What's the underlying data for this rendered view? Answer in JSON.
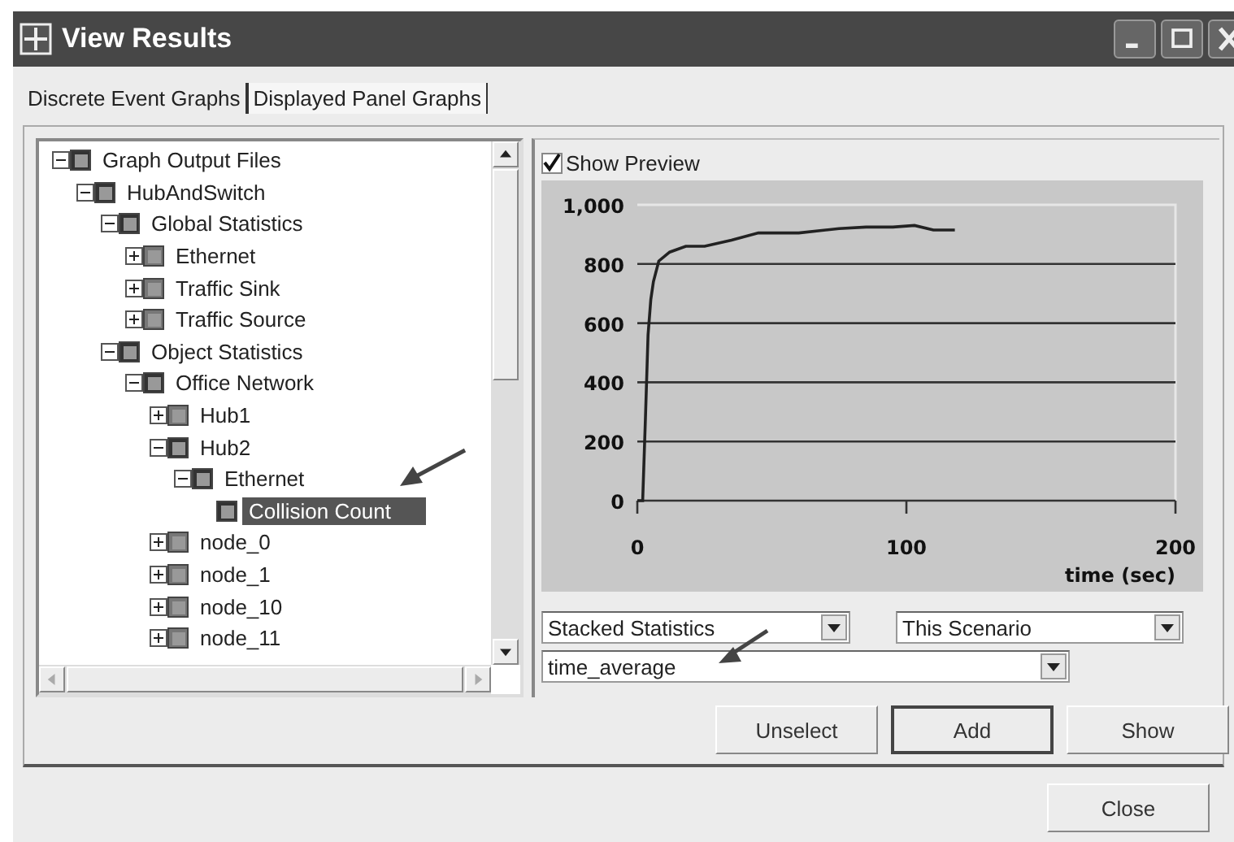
{
  "window": {
    "title": "View Results"
  },
  "tabs": [
    {
      "label": "Discrete Event Graphs",
      "selected": true
    },
    {
      "label": "Displayed Panel Graphs",
      "selected": false
    }
  ],
  "tree": [
    {
      "label": "Graph Output Files",
      "expanded": true,
      "selected": false,
      "children": [
        {
          "label": "HubAndSwitch",
          "expanded": true,
          "selected": false,
          "children": [
            {
              "label": "Global Statistics",
              "expanded": true,
              "selected": false,
              "children": [
                {
                  "label": "Ethernet",
                  "expanded": false,
                  "selected": false
                },
                {
                  "label": "Traffic Sink",
                  "expanded": false,
                  "selected": false
                },
                {
                  "label": "Traffic Source",
                  "expanded": false,
                  "selected": false
                }
              ]
            },
            {
              "label": "Object Statistics",
              "expanded": true,
              "selected": false,
              "children": [
                {
                  "label": "Office Network",
                  "expanded": true,
                  "selected": false,
                  "children": [
                    {
                      "label": "Hub1",
                      "expanded": false,
                      "selected": false
                    },
                    {
                      "label": "Hub2",
                      "expanded": true,
                      "selected": false,
                      "children": [
                        {
                          "label": "Ethernet",
                          "expanded": true,
                          "selected": false,
                          "children": [
                            {
                              "label": "Collision Count",
                              "selected": true
                            }
                          ]
                        }
                      ]
                    },
                    {
                      "label": "node_0",
                      "expanded": false,
                      "selected": false
                    },
                    {
                      "label": "node_1",
                      "expanded": false,
                      "selected": false
                    },
                    {
                      "label": "node_10",
                      "expanded": false,
                      "selected": false
                    },
                    {
                      "label": "node_11",
                      "expanded": false,
                      "selected": false
                    }
                  ]
                }
              ]
            }
          ]
        }
      ]
    }
  ],
  "preview": {
    "show_preview": {
      "label": "Show Preview",
      "checked": true
    },
    "chart_data": {
      "type": "line",
      "grid": true,
      "xlabel": "time (sec)",
      "xlim": [
        0,
        200
      ],
      "ylim": [
        0,
        1000
      ],
      "xticks": [
        0,
        100,
        200
      ],
      "yticks": [
        0,
        200,
        400,
        600,
        800,
        {
          "value": 1000,
          "label": "1,000"
        }
      ],
      "x": [
        0,
        2,
        3,
        4,
        5,
        6,
        8,
        12,
        18,
        25,
        35,
        45,
        60,
        75,
        85,
        95,
        103,
        110,
        118
      ],
      "series": [
        {
          "color": "#222222",
          "values": [
            0,
            0,
            280,
            560,
            680,
            740,
            810,
            840,
            860,
            860,
            880,
            905,
            905,
            920,
            925,
            925,
            930,
            915,
            915
          ]
        }
      ]
    }
  },
  "selectors": [
    {
      "value": "Stacked Statistics"
    },
    {
      "value": "This Scenario"
    },
    {
      "value": "time_average"
    }
  ],
  "buttons": [
    {
      "label": "Unselect",
      "default": false
    },
    {
      "label": "Add",
      "default": true
    },
    {
      "label": "Show",
      "default": false
    }
  ],
  "close_button": {
    "label": "Close"
  }
}
